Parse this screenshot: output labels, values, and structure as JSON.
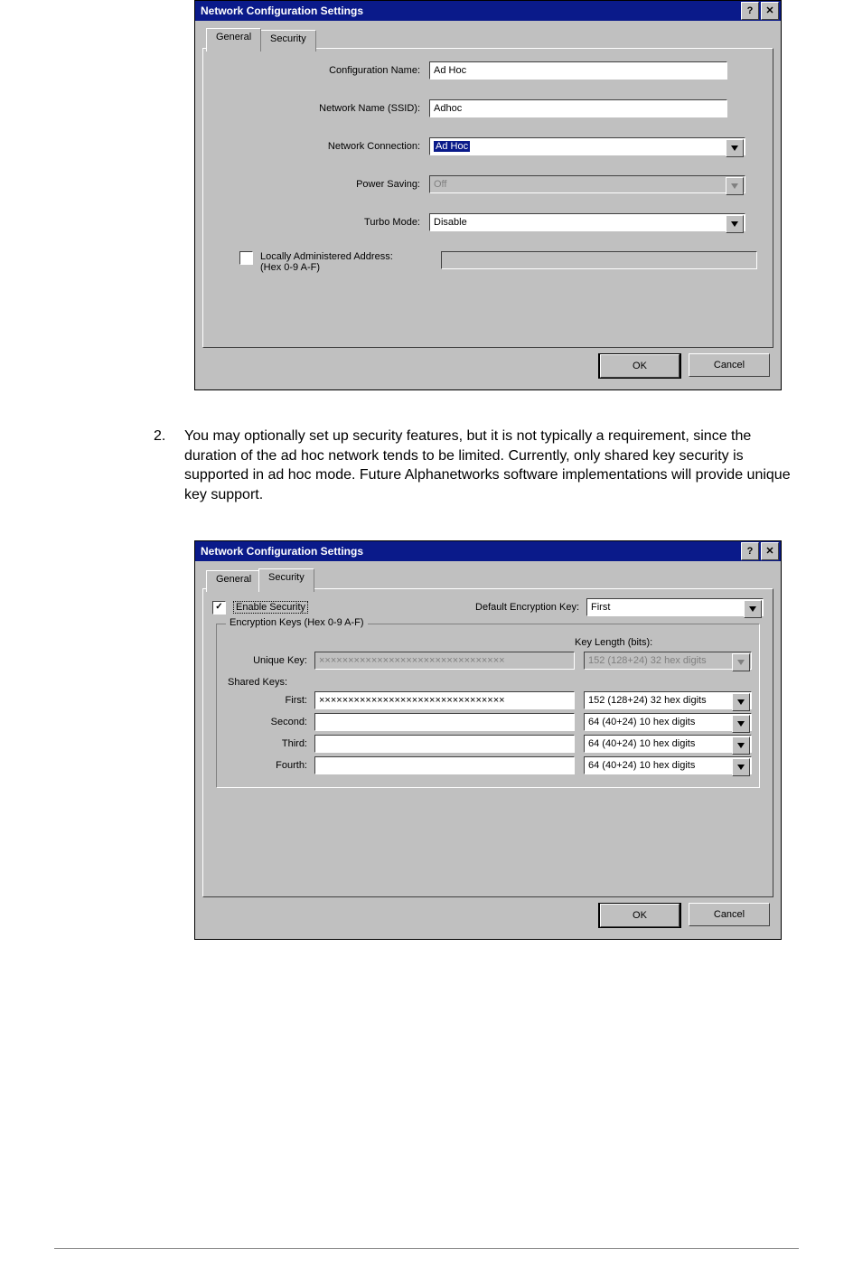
{
  "dialog1": {
    "title": "Network Configuration Settings",
    "help_btn": "?",
    "close_btn": "✕",
    "tabs": {
      "general": "General",
      "security": "Security"
    },
    "fields": {
      "config_name": {
        "label": "Configuration Name:",
        "value": "Ad Hoc"
      },
      "ssid": {
        "label": "Network Name (SSID):",
        "value": "Adhoc"
      },
      "connection": {
        "label": "Network Connection:",
        "value": "Ad Hoc"
      },
      "power": {
        "label": "Power Saving:",
        "value": "Off"
      },
      "turbo": {
        "label": "Turbo Mode:",
        "value": "Disable"
      },
      "laa": {
        "label": "Locally Administered Address:\n(Hex 0-9 A-F)",
        "value": ""
      }
    },
    "buttons": {
      "ok": "OK",
      "cancel": "Cancel"
    }
  },
  "paragraph": "You may optionally set up security features, but it is not typically a requirement, since the duration of the ad hoc network tends to be limited. Currently, only shared key security is supported in ad hoc mode. Future Alphanetworks software implementations will provide unique key support.",
  "dialog2": {
    "title": "Network Configuration Settings",
    "help_btn": "?",
    "close_btn": "✕",
    "tabs": {
      "general": "General",
      "security": "Security"
    },
    "enable_security": {
      "label": "Enable Security",
      "checked": "✓"
    },
    "default_key": {
      "label": "Default Encryption Key:",
      "value": "First"
    },
    "group_legend": "Encryption Keys (Hex 0-9 A-F)",
    "key_length_header": "Key Length (bits):",
    "unique": {
      "label": "Unique Key:",
      "value": "××××××××××××××××××××××××××××××××",
      "length": "152 (128+24) 32 hex digits"
    },
    "shared_label": "Shared Keys:",
    "keys": [
      {
        "label": "First:",
        "value": "××××××××××××××××××××××××××××××××",
        "length": "152 (128+24) 32 hex digits"
      },
      {
        "label": "Second:",
        "value": "",
        "length": "64  (40+24)  10 hex digits"
      },
      {
        "label": "Third:",
        "value": "",
        "length": "64  (40+24)  10 hex digits"
      },
      {
        "label": "Fourth:",
        "value": "",
        "length": "64  (40+24)  10 hex digits"
      }
    ],
    "buttons": {
      "ok": "OK",
      "cancel": "Cancel"
    }
  }
}
